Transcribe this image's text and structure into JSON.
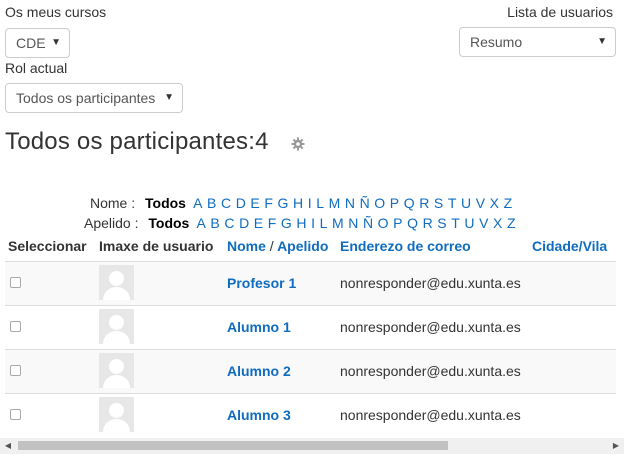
{
  "filters": {
    "courses_label": "Os meus cursos",
    "course_value": "CDE",
    "user_list_label": "Lista de usuarios",
    "user_list_value": "Resumo",
    "role_label": "Rol actual",
    "role_value": "Todos os participantes"
  },
  "page_title": "Todos os participantes:4",
  "alphabet": {
    "first_name_label": "Nome :",
    "last_name_label": "Apelido :",
    "all_label": "Todos",
    "letters": [
      "A",
      "B",
      "C",
      "D",
      "E",
      "F",
      "G",
      "H",
      "I",
      "L",
      "M",
      "N",
      "Ñ",
      "O",
      "P",
      "Q",
      "R",
      "S",
      "T",
      "U",
      "V",
      "X",
      "Z"
    ]
  },
  "table": {
    "headers": {
      "select": "Seleccionar",
      "image": "Imaxe de usuario",
      "name": "Nome",
      "separator": "/",
      "surname": "Apelido",
      "email": "Enderezo de correo",
      "city": "Cidade/Vila"
    },
    "rows": [
      {
        "name": "Profesor 1",
        "email": "nonresponder@edu.xunta.es"
      },
      {
        "name": "Alumno 1",
        "email": "nonresponder@edu.xunta.es"
      },
      {
        "name": "Alumno 2",
        "email": "nonresponder@edu.xunta.es"
      },
      {
        "name": "Alumno 3",
        "email": "nonresponder@edu.xunta.es"
      }
    ]
  },
  "icons": {
    "settings": "gear-icon",
    "select_caret": "caret-down-icon",
    "avatar": "default-user-icon"
  },
  "colors": {
    "link": "#0f6cbf",
    "text": "#333333",
    "row_stripe": "#f9f9f9"
  }
}
